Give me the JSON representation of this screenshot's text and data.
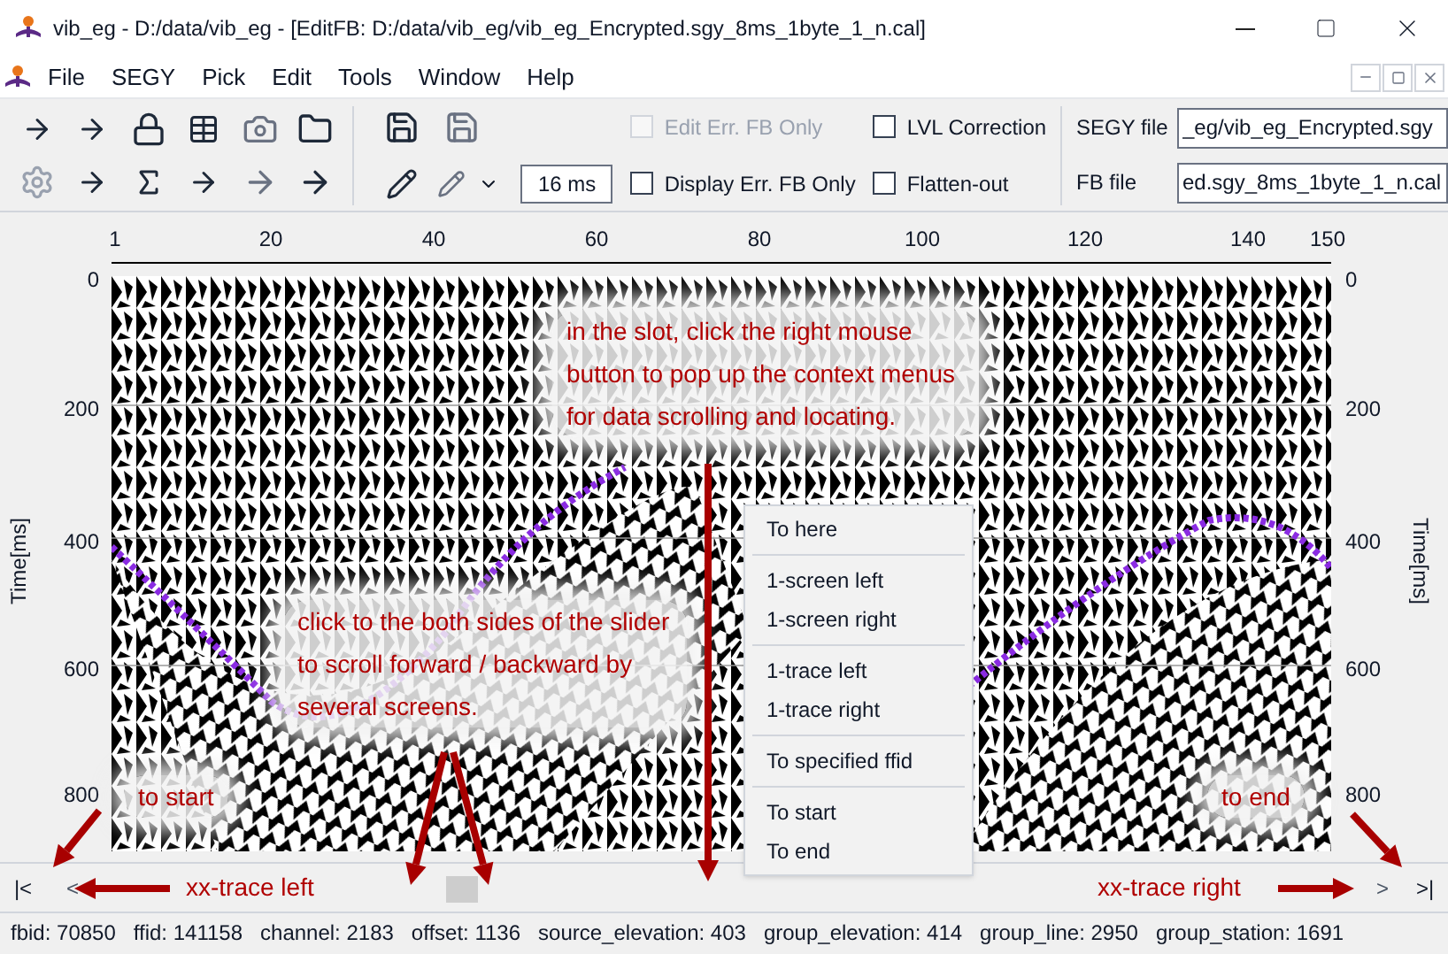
{
  "window": {
    "title": "vib_eg - D:/data/vib_eg - [EditFB: D:/data/vib_eg/vib_eg_Encrypted.sgy_8ms_1byte_1_n.cal]"
  },
  "menu_bar": {
    "items": [
      "File",
      "SEGY",
      "Pick",
      "Edit",
      "Tools",
      "Window",
      "Help"
    ]
  },
  "toolbar": {
    "checkboxes": [
      {
        "label": "Edit Err. FB Only",
        "checked": false,
        "disabled": true
      },
      {
        "label": "LVL Correction",
        "checked": false,
        "disabled": false
      },
      {
        "label": "Display Err. FB Only",
        "checked": false,
        "disabled": false
      },
      {
        "label": "Flatten-out",
        "checked": false,
        "disabled": false
      }
    ],
    "interval": {
      "value": "16 ms"
    },
    "segy_file": {
      "label": "SEGY file",
      "value": "_eg/vib_eg_Encrypted.sgy"
    },
    "fb_file": {
      "label": "FB file",
      "value": "ed.sgy_8ms_1byte_1_n.cal"
    }
  },
  "plot": {
    "top_axis": {
      "ticks": [
        "1",
        "20",
        "40",
        "60",
        "80",
        "100",
        "120",
        "140",
        "150"
      ]
    },
    "left_axis": {
      "label": "Time[ms]",
      "ticks": [
        "0",
        "200",
        "400",
        "600",
        "800"
      ]
    },
    "right_axis": {
      "label": "Time[ms]",
      "ticks": [
        "0",
        "200",
        "400",
        "600",
        "800"
      ]
    }
  },
  "annotations": [
    "in the slot, click the right mouse button to pop up the context menus for data scrolling and locating.",
    "click to the both sides of the slider to scroll forward / backward by several screens.",
    "to start",
    "to end",
    "xx-trace left",
    "xx-trace right"
  ],
  "context_menu": {
    "groups": [
      [
        "To here"
      ],
      [
        "1-screen left",
        "1-screen right"
      ],
      [
        "1-trace left",
        "1-trace right"
      ],
      [
        "To specified ffid"
      ],
      [
        "To start",
        "To end"
      ]
    ]
  },
  "scroll_bar": {
    "buttons": [
      "|<",
      "<",
      ">",
      ">|"
    ]
  },
  "status_bar": {
    "fields": [
      "fbid: 70850",
      "ffid: 141158",
      "channel: 2183",
      "offset: 1136",
      "source_elevation: 403",
      "group_elevation: 414",
      "group_line: 2950",
      "group_station: 1691"
    ]
  }
}
